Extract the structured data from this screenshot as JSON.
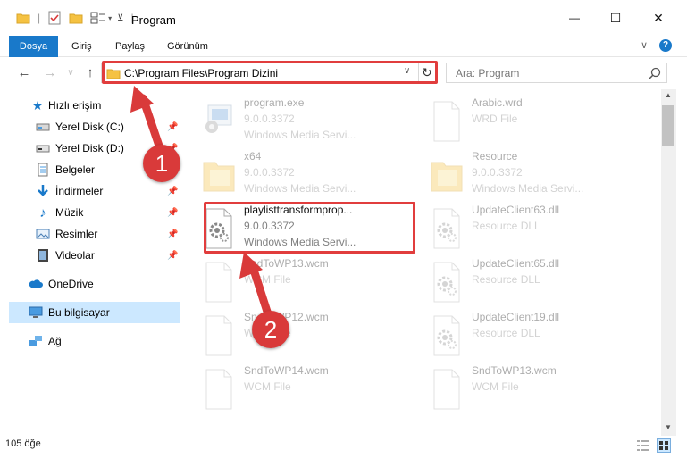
{
  "window": {
    "title": "Program",
    "minimize_glyph": "—",
    "maximize_glyph": "☐",
    "close_glyph": "✕"
  },
  "ribbon": {
    "tabs": [
      {
        "label": "Dosya",
        "active": true
      },
      {
        "label": "Giriş",
        "active": false
      },
      {
        "label": "Paylaş",
        "active": false
      },
      {
        "label": "Görünüm",
        "active": false
      }
    ],
    "expand_glyph": "∨",
    "help_glyph": "?"
  },
  "nav": {
    "back_glyph": "←",
    "forward_glyph": "→",
    "recent_glyph": "∨",
    "up_glyph": "↑",
    "address": "C:\\Program Files\\Program Dizini",
    "refresh_glyph": "↻",
    "search_placeholder": "Ara: Program",
    "search_icon": "search-icon"
  },
  "sidebar": {
    "quick_access": "Hızlı erişim",
    "items": [
      {
        "label": "Yerel Disk (C:)",
        "icon": "drive-icon",
        "pinned": true
      },
      {
        "label": "Yerel Disk (D:)",
        "icon": "drive-icon",
        "pinned": true
      },
      {
        "label": "Belgeler",
        "icon": "documents-icon",
        "pinned": false
      },
      {
        "label": "İndirmeler",
        "icon": "download-icon",
        "pinned": true
      },
      {
        "label": "Müzik",
        "icon": "music-icon",
        "pinned": true
      },
      {
        "label": "Resimler",
        "icon": "pictures-icon",
        "pinned": true
      },
      {
        "label": "Videolar",
        "icon": "videos-icon",
        "pinned": true
      }
    ],
    "onedrive": "OneDrive",
    "this_pc": "Bu bilgisayar",
    "network": "Ağ"
  },
  "files": [
    {
      "name": "program.exe",
      "version": "9.0.0.3372",
      "type": "Windows Media Servi...",
      "icon": "exe-icon"
    },
    {
      "name": "Arabic.wrd",
      "version": "WRD File",
      "type": "",
      "icon": "blank-file-icon"
    },
    {
      "name": "x64",
      "version": "9.0.0.3372",
      "type": "Windows Media Servi...",
      "icon": "folder-icon"
    },
    {
      "name": "Resource",
      "version": "9.0.0.3372",
      "type": "Windows Media Servi...",
      "icon": "folder-icon"
    },
    {
      "name": "playlisttransformprop...",
      "version": "9.0.0.3372",
      "type": "Windows Media Servi...",
      "icon": "dll-gear-icon"
    },
    {
      "name": "UpdateClient63.dll",
      "version": "Resource DLL",
      "type": "",
      "icon": "dll-gear-icon"
    },
    {
      "name": "SndToWP13.wcm",
      "version": "WCM File",
      "type": "",
      "icon": "blank-file-icon"
    },
    {
      "name": "UpdateClient65.dll",
      "version": "Resource DLL",
      "type": "",
      "icon": "dll-gear-icon"
    },
    {
      "name": "SndToWP12.wcm",
      "version": "WCM File",
      "type": "",
      "icon": "blank-file-icon"
    },
    {
      "name": "UpdateClient19.dll",
      "version": "Resource DLL",
      "type": "",
      "icon": "dll-gear-icon"
    },
    {
      "name": "SndToWP14.wcm",
      "version": "WCM File",
      "type": "",
      "icon": "blank-file-icon"
    },
    {
      "name": "SndToWP13.wcm",
      "version": "WCM File",
      "type": "",
      "icon": "blank-file-icon"
    }
  ],
  "markers": [
    "1",
    "2"
  ],
  "status": {
    "count": "105 öğe"
  },
  "colors": {
    "accent": "#1979ca",
    "highlight": "#e13d3d",
    "selected": "#cce8ff",
    "folder": "#f5c242"
  }
}
